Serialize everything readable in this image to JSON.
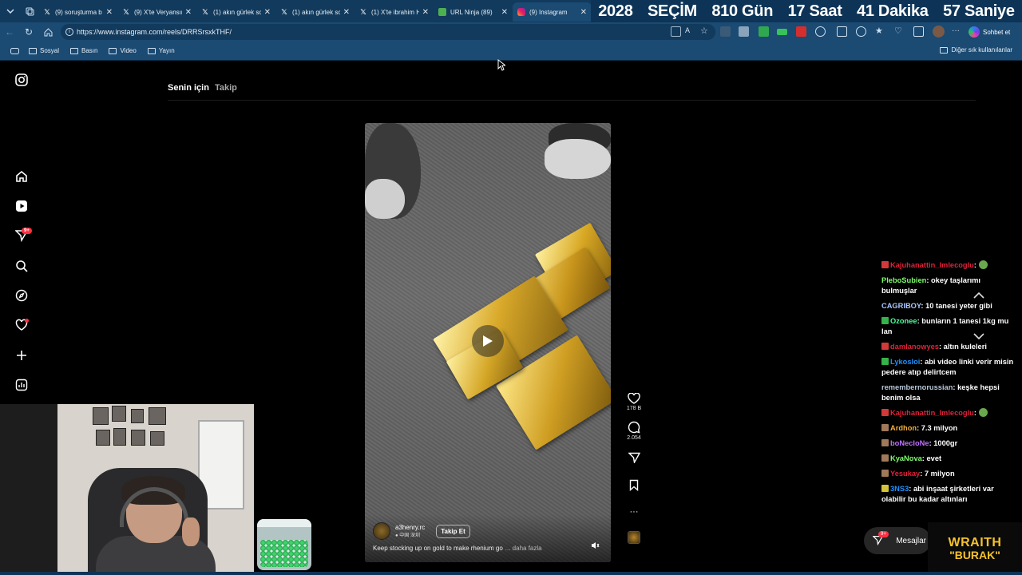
{
  "browser": {
    "tabs": [
      {
        "title": "(9) soruşturma b",
        "icon": "x-logo-icon",
        "active": false
      },
      {
        "title": "(9) X'te Veryansın",
        "icon": "x-logo-icon",
        "active": false
      },
      {
        "title": "(1) akın gürlek sc",
        "icon": "x-logo-icon",
        "active": false
      },
      {
        "title": "(1) akın gürlek sc",
        "icon": "x-logo-icon",
        "active": false
      },
      {
        "title": "(1) X'te ibrahim H",
        "icon": "x-logo-icon",
        "active": false
      },
      {
        "title": "URL Ninja (89)",
        "icon": "ninja-icon",
        "active": false
      },
      {
        "title": "(9) Instagram",
        "icon": "instagram-icon",
        "active": true
      }
    ],
    "url": "https://www.instagram.com/reels/DRRSrsxkTHF/",
    "chat_button_label": "Sohbet et",
    "bookmarks": [
      "Sosyal",
      "Basın",
      "Video",
      "Yayın"
    ],
    "other_bookmarks_label": "Diğer sık kullanılanlar"
  },
  "countdown": {
    "segments": [
      "2028",
      "SEÇİM",
      "810 Gün",
      "17 Saat",
      "41 Dakika",
      "57 Saniye"
    ]
  },
  "instagram": {
    "sidebar_icons": [
      "instagram-logo-icon",
      "home-icon",
      "reels-icon",
      "messages-icon",
      "search-icon",
      "explore-icon",
      "notifications-icon",
      "create-icon",
      "dashboard-icon"
    ],
    "messages_badge": "9+",
    "feed_tabs": {
      "for_you": "Senin için",
      "following": "Takip"
    },
    "reel": {
      "author": "a3henry.rc",
      "location": "中国 深圳",
      "follow_label": "Takip Et",
      "caption": "Keep stocking up on gold to make rhenium go",
      "more_label": "... daha fazla",
      "likes": "178 B",
      "comments": "2.054"
    },
    "messages_button": {
      "label": "Mesajlar",
      "badge": "9+"
    }
  },
  "stream_chat": [
    {
      "user": "Kajuhanattin_Imlecoglu",
      "text": "",
      "user_color": "#e0223a",
      "icon_color": "#d23a3a"
    },
    {
      "user": "PleboSubien",
      "text": "okey taşlarımı bulmuşlar",
      "user_color": "#7dff6a",
      "icon_color": ""
    },
    {
      "user": "CAGRIBOY",
      "text": "10 tanesi yeter gibi",
      "user_color": "#a9c6ff",
      "icon_color": ""
    },
    {
      "user": "Ozonee",
      "text": "bunların 1 tanesi 1kg mu lan",
      "user_color": "#4cff9a",
      "icon_color": "#35b24a"
    },
    {
      "user": "damlanowyes",
      "text": "altın kuleleri",
      "user_color": "#e0223a",
      "icon_color": "#d23a3a"
    },
    {
      "user": "Lykosloi",
      "text": "abi video linki verir misin pedere atıp delirtcem",
      "user_color": "#1e90ff",
      "icon_color": "#35b24a"
    },
    {
      "user": "remembernorussian",
      "text": "keşke hepsi benim olsa",
      "user_color": "#b7c7d8",
      "icon_color": ""
    },
    {
      "user": "Kajuhanattin_Imlecoglu",
      "text": "",
      "user_color": "#e0223a",
      "icon_color": "#d23a3a"
    },
    {
      "user": "Ardhon",
      "text": "7.3 milyon",
      "user_color": "#f0b040",
      "icon_color": "#a0785a"
    },
    {
      "user": "boNecloNe",
      "text": "1000gr",
      "user_color": "#c070ff",
      "icon_color": "#a0785a"
    },
    {
      "user": "KyaNova",
      "text": "evet",
      "user_color": "#7dff6a",
      "icon_color": "#a0785a"
    },
    {
      "user": "Yesukay",
      "text": "7 milyon",
      "user_color": "#e0223a",
      "icon_color": "#a0785a"
    },
    {
      "user": "3NS3",
      "text": "abi inşaat şirketleri var olabilir bu kadar altınları",
      "user_color": "#1e90ff",
      "icon_color": "#d4c23a"
    }
  ],
  "brand_overlay": {
    "line1": "WRAITH",
    "line2": "\"BURAK\""
  },
  "colors": {
    "browser_chrome": "#1b4a72",
    "tabbar": "#123a5c",
    "countdown_bg": "#0d3457",
    "ig_badge": "#ff3040",
    "gold": "#f6c22b"
  }
}
